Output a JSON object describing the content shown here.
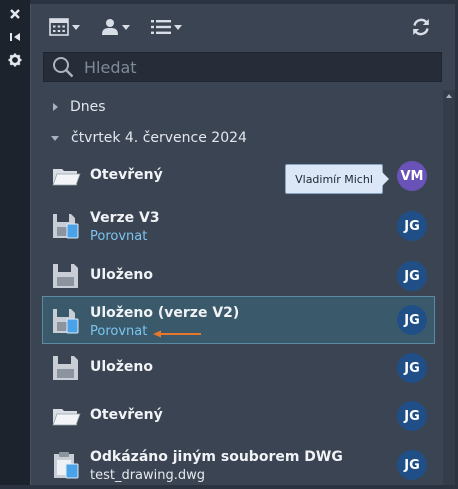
{
  "side_strip": {
    "buttons": [
      {
        "name": "close-icon",
        "glyph": "✕"
      },
      {
        "name": "collapse-icon",
        "glyph": "⏮"
      },
      {
        "name": "gear-icon",
        "glyph": "⚙"
      }
    ]
  },
  "toolbar": {
    "calendar_icon": "calendar-icon",
    "user_icon": "user-icon",
    "list_icon": "list-icon",
    "refresh_icon": "refresh-icon"
  },
  "search": {
    "placeholder": "Hledat"
  },
  "groups": [
    {
      "label": "Dnes",
      "expanded": false
    },
    {
      "label": "čtvrtek 4. července 2024",
      "expanded": true
    }
  ],
  "tooltip": {
    "text": "Vladimír Michl"
  },
  "items": [
    {
      "title": "Otevřený",
      "subtitle": "",
      "icon": "folder-icon",
      "avatar": "VM"
    },
    {
      "title": "Verze V3",
      "subtitle": "Porovnat",
      "icon": "save-version-icon",
      "avatar": "JG"
    },
    {
      "title": "Uloženo",
      "subtitle": "",
      "icon": "save-icon",
      "avatar": "JG"
    },
    {
      "title": "Uloženo (verze V2)",
      "subtitle": "Porovnat",
      "icon": "save-version-icon",
      "avatar": "JG",
      "selected": true
    },
    {
      "title": "Uloženo",
      "subtitle": "",
      "icon": "save-icon",
      "avatar": "JG"
    },
    {
      "title": "Otevřený",
      "subtitle": "",
      "icon": "folder-icon",
      "avatar": "JG"
    },
    {
      "title": "Odkázáno jiným souborem DWG",
      "subtitle": "test_drawing.dwg",
      "icon": "clipboard-icon",
      "avatar": "JG"
    }
  ],
  "colors": {
    "accent_link": "#7cc4ee",
    "avatar_jg": "#1f4f86",
    "avatar_vm": "#6a53b8",
    "highlight_arrow": "#e8772e"
  }
}
